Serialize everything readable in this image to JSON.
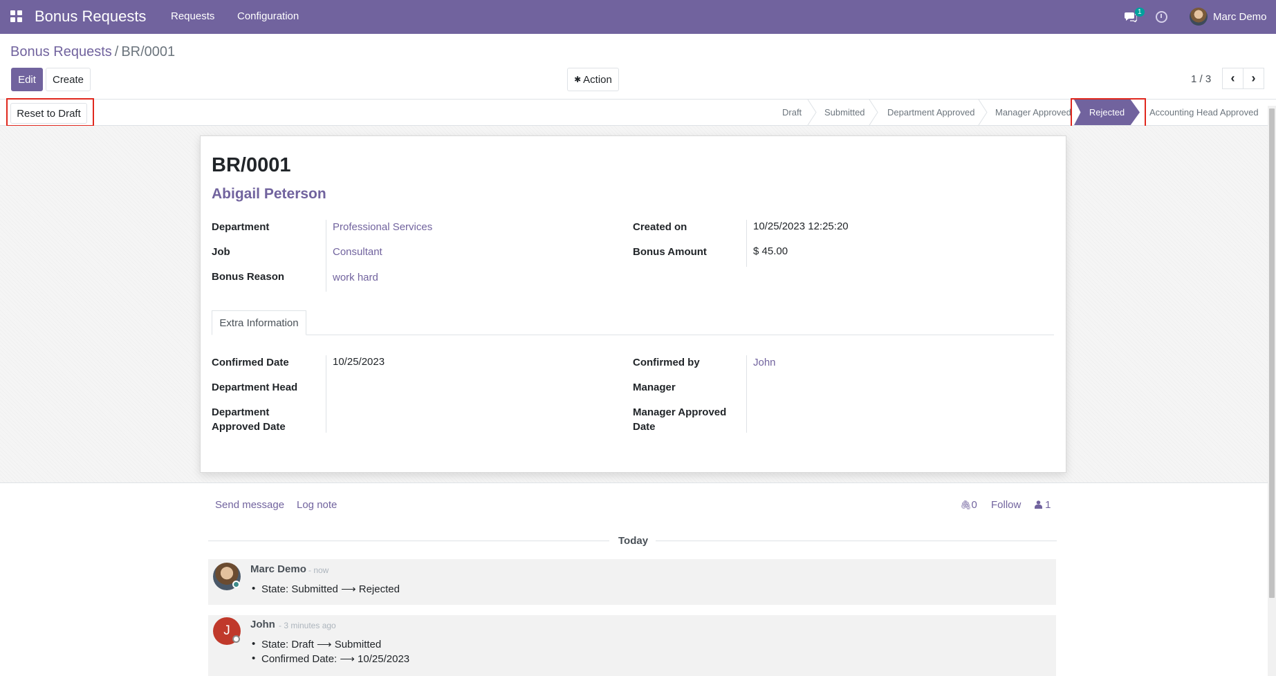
{
  "navbar": {
    "brand": "Bonus Requests",
    "menu": [
      "Requests",
      "Configuration"
    ],
    "chat_badge": "1",
    "user_name": "Marc Demo"
  },
  "breadcrumb": {
    "parent": "Bonus Requests",
    "current": "BR/0001"
  },
  "toolbar": {
    "edit_label": "Edit",
    "create_label": "Create",
    "action_label": "Action",
    "pager": "1 / 3"
  },
  "statusbar": {
    "reset_label": "Reset to Draft",
    "stages": [
      "Draft",
      "Submitted",
      "Department Approved",
      "Manager Approved",
      "Rejected",
      "Accounting Head Approved"
    ],
    "active_stage": "Rejected"
  },
  "record": {
    "reference": "BR/0001",
    "employee": "Abigail Peterson",
    "fields_left": [
      {
        "label": "Department",
        "value": "Professional Services"
      },
      {
        "label": "Job",
        "value": "Consultant"
      },
      {
        "label": "Bonus Reason",
        "value": "work hard"
      }
    ],
    "fields_right": [
      {
        "label": "Created on",
        "value": "10/25/2023 12:25:20"
      },
      {
        "label": "Bonus Amount",
        "value": "$ 45.00"
      }
    ]
  },
  "tab": {
    "label": "Extra Information",
    "fields_left": [
      {
        "label": "Confirmed Date",
        "value": "10/25/2023"
      },
      {
        "label": "Department Head",
        "value": ""
      },
      {
        "label": "Department Approved Date",
        "label_line1": "Department",
        "label_line2": "Approved Date",
        "value": ""
      }
    ],
    "fields_right": [
      {
        "label": "Confirmed by",
        "value": "John"
      },
      {
        "label": "Manager",
        "value": ""
      },
      {
        "label": "Manager Approved Date",
        "label_line1": "Manager Approved",
        "label_line2": "Date",
        "value": ""
      }
    ]
  },
  "chatter": {
    "send_message": "Send message",
    "log_note": "Log note",
    "attachments": "0",
    "follow": "Follow",
    "followers": "1",
    "today": "Today",
    "messages": [
      {
        "author": "Marc Demo",
        "time": "- now",
        "lines": [
          "State: Submitted ⟶ Rejected"
        ],
        "avatar_initial": ""
      },
      {
        "author": "John",
        "time": "- 3 minutes ago",
        "lines": [
          "State: Draft ⟶ Submitted",
          "Confirmed Date: ⟶ 10/25/2023"
        ],
        "avatar_initial": "J"
      }
    ]
  },
  "colors": {
    "brand": "#71639e",
    "highlight_box": "#e0271d",
    "john_avatar": "#c0392b"
  }
}
